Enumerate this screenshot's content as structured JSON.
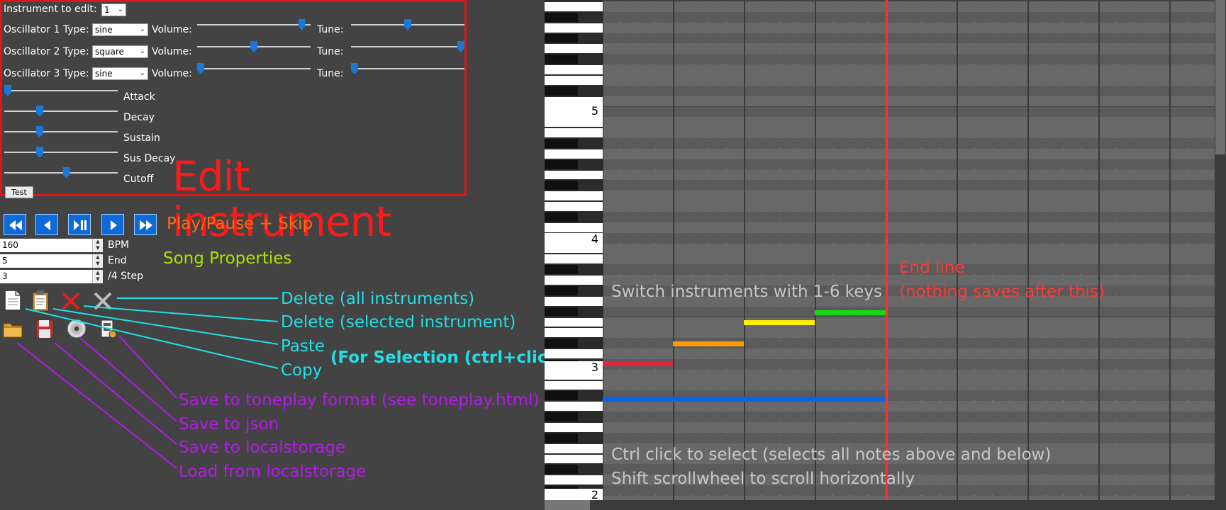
{
  "editor": {
    "instrument_label": "Instrument to edit:",
    "instrument_value": "1",
    "volume_label": "Volume:",
    "tune_label": "Tune:",
    "oscillators": [
      {
        "label": "Oscillator 1 Type:",
        "type": "sine",
        "volume": 0.95,
        "tune": 0.5
      },
      {
        "label": "Oscillator 2 Type:",
        "type": "square",
        "volume": 0.5,
        "tune": 1.0
      },
      {
        "label": "Oscillator 3 Type:",
        "type": "sine",
        "volume": 0.0,
        "tune": 0.0
      }
    ],
    "envelope": [
      {
        "label": "Attack",
        "value": 0.0
      },
      {
        "label": "Decay",
        "value": 0.3
      },
      {
        "label": "Sustain",
        "value": 0.3
      },
      {
        "label": "Sus Decay",
        "value": 0.3
      },
      {
        "label": "Cutoff",
        "value": 0.55
      }
    ],
    "title": "Edit instrument",
    "test_label": "Test"
  },
  "transport": {
    "caption": "Play/Pause + Skip"
  },
  "song": {
    "caption": "Song Properties",
    "fields": [
      {
        "value": "160",
        "label": "BPM"
      },
      {
        "value": "5",
        "label": "End"
      },
      {
        "value": "3",
        "label": "/4 Step"
      }
    ]
  },
  "annotations": {
    "delete_all": "Delete (all instruments)",
    "delete_selected": "Delete (selected instrument)",
    "paste": "Paste",
    "copy": "Copy",
    "for_selection": "(For Selection (ctrl+click))",
    "save_toneplay": "Save to toneplay format (see toneplay.html)",
    "save_json": "Save to json",
    "save_local": "Save to localstorage",
    "load_local": "Load from localstorage"
  },
  "roll": {
    "octave_labels": [
      "5",
      "4",
      "3",
      "2"
    ],
    "switch_hint": "Switch instruments with 1-6 keys",
    "end_line_label": "End line",
    "end_line_note": "(nothing saves after this)",
    "ctrl_hint": "Ctrl click to select (selects all notes above and below)",
    "shift_hint": "Shift scrollwheel to scroll horizontally"
  },
  "colors": {
    "edit_border": "#e01515",
    "end_line": "#ff3030",
    "note_red": "#e8213a",
    "note_orange": "#ff9a00",
    "note_yellow": "#ffee00",
    "note_green": "#14d914",
    "note_blue": "#0b62e6"
  }
}
